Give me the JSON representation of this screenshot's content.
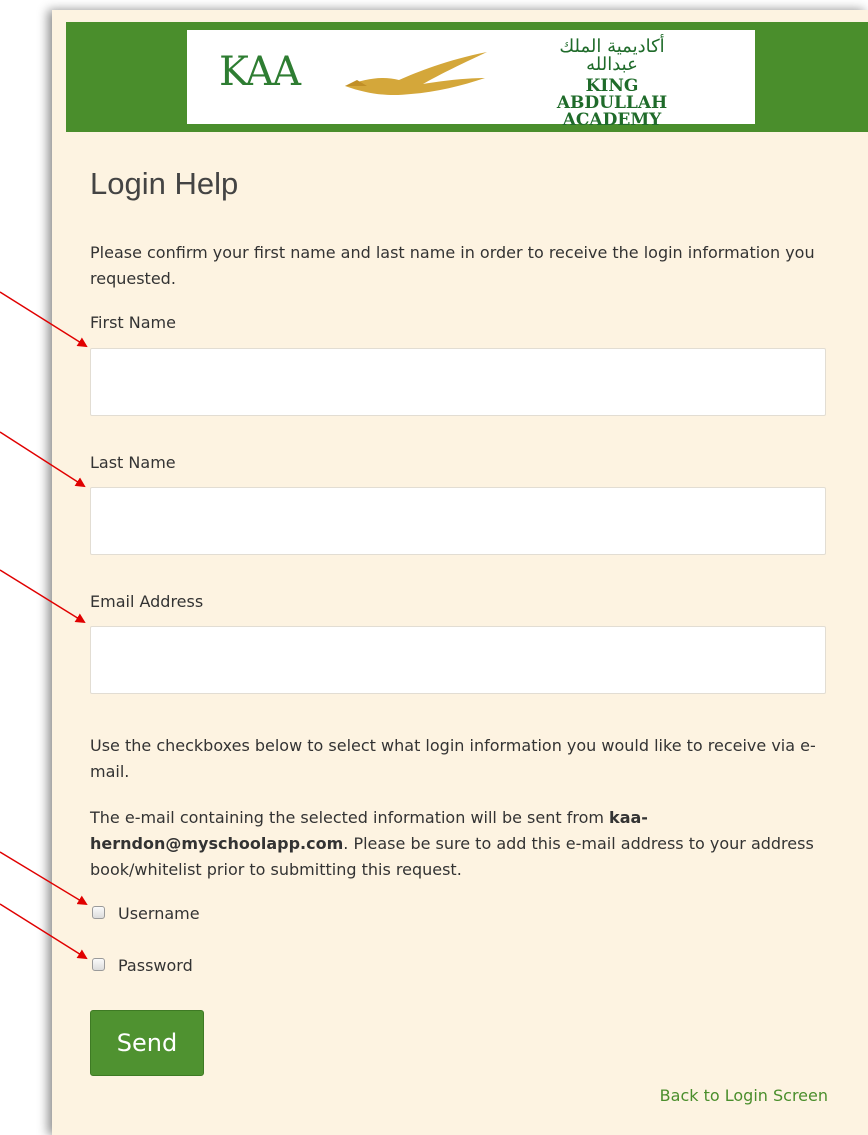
{
  "logo": {
    "kaa_mark": "KAA",
    "arabic_name": "أكاديمية الملك عبدالله",
    "english_line1": "KING ABDULLAH",
    "english_line2": "ACADEMY"
  },
  "page_title": "Login Help",
  "intro": "Please confirm your first name and last name in order to receive the login information you requested.",
  "fields": {
    "first_name": {
      "label": "First Name",
      "value": ""
    },
    "last_name": {
      "label": "Last Name",
      "value": ""
    },
    "email": {
      "label": "Email Address",
      "value": ""
    }
  },
  "checkbox_instructions": "Use the checkboxes below to select what login information you would like to receive via e-mail.",
  "sender_notice": {
    "prefix": "The e-mail containing the selected information will be sent from ",
    "email_line1": "kaa-",
    "email_line2": "herndon@myschoolapp.com",
    "suffix": ". Please be sure to add this e-mail address to your address book/whitelist prior to submitting this request."
  },
  "options": {
    "username": {
      "label": "Username",
      "checked": false
    },
    "password": {
      "label": "Password",
      "checked": false
    }
  },
  "send_label": "Send",
  "back_link": "Back to Login Screen",
  "colors": {
    "brand_green": "#4a8e2c",
    "button_green": "#4f9230",
    "page_bg": "#fdf3e1",
    "annotation_red": "#e00000",
    "logo_gold": "#d4a73a"
  },
  "icons": [
    "falcon-logo-icon",
    "annotation-arrow-icon"
  ]
}
